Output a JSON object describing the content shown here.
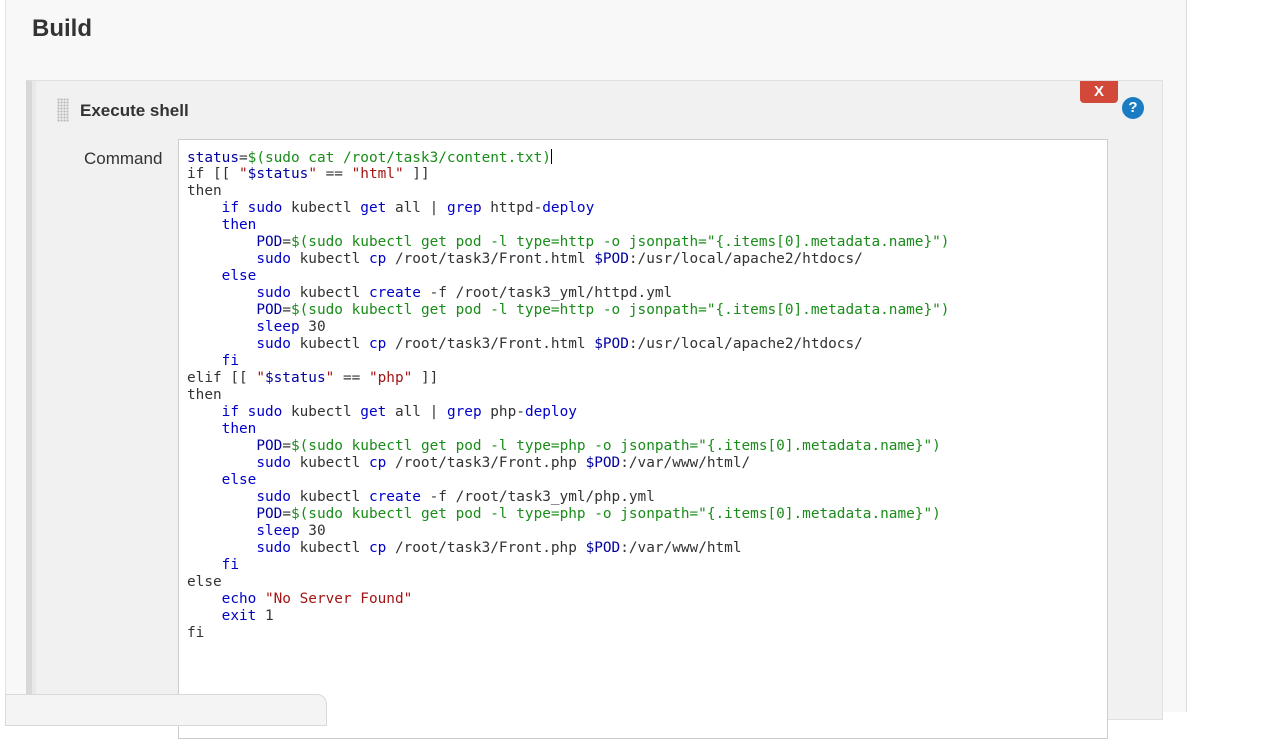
{
  "section": {
    "title": "Build"
  },
  "step": {
    "title": "Execute shell",
    "delete_label": "X",
    "help_label": "?",
    "command_label": "Command"
  },
  "colors": {
    "delete_button": "#d24939",
    "help_icon": "#1a7dc4",
    "variable": "#0000a0",
    "substitution": "#1a8c1a",
    "string": "#a31515"
  },
  "command_lines": [
    [
      [
        "var",
        "status"
      ],
      [
        "txt",
        "="
      ],
      [
        "sub",
        "$(sudo cat /root/task3/content.txt)"
      ]
    ],
    [
      [
        "txt",
        "if [[ "
      ],
      [
        "str",
        "\""
      ],
      [
        "var",
        "$status"
      ],
      [
        "str",
        "\""
      ],
      [
        "txt",
        " == "
      ],
      [
        "str",
        "\"html\""
      ],
      [
        "txt",
        " ]]"
      ]
    ],
    [
      [
        "txt",
        "then"
      ]
    ],
    [
      [
        "txt",
        "    "
      ],
      [
        "cmd",
        "if"
      ],
      [
        "txt",
        " "
      ],
      [
        "cmd",
        "sudo"
      ],
      [
        "txt",
        " kubectl "
      ],
      [
        "cmd",
        "get"
      ],
      [
        "txt",
        " all | "
      ],
      [
        "cmd",
        "grep"
      ],
      [
        "txt",
        " httpd-"
      ],
      [
        "cmd",
        "deploy"
      ]
    ],
    [
      [
        "txt",
        "    "
      ],
      [
        "cmd",
        "then"
      ]
    ],
    [
      [
        "txt",
        "        "
      ],
      [
        "var",
        "POD"
      ],
      [
        "txt",
        "="
      ],
      [
        "sub",
        "$(sudo kubectl get pod -l type=http -o jsonpath=\"{.items[0].metadata.name}\")"
      ]
    ],
    [
      [
        "txt",
        "        "
      ],
      [
        "cmd",
        "sudo"
      ],
      [
        "txt",
        " kubectl "
      ],
      [
        "cmd",
        "cp"
      ],
      [
        "txt",
        " /root/task3/Front.html "
      ],
      [
        "var",
        "$POD"
      ],
      [
        "txt",
        ":/usr/local/apache2/htdocs/"
      ]
    ],
    [
      [
        "txt",
        "    "
      ],
      [
        "cmd",
        "else"
      ]
    ],
    [
      [
        "txt",
        "        "
      ],
      [
        "cmd",
        "sudo"
      ],
      [
        "txt",
        " kubectl "
      ],
      [
        "cmd",
        "create"
      ],
      [
        "txt",
        " -f /root/task3_yml/httpd.yml"
      ]
    ],
    [
      [
        "txt",
        "        "
      ],
      [
        "var",
        "POD"
      ],
      [
        "txt",
        "="
      ],
      [
        "sub",
        "$(sudo kubectl get pod -l type=http -o jsonpath=\"{.items[0].metadata.name}\")"
      ]
    ],
    [
      [
        "txt",
        "        "
      ],
      [
        "cmd",
        "sleep"
      ],
      [
        "txt",
        " 30"
      ]
    ],
    [
      [
        "txt",
        "        "
      ],
      [
        "cmd",
        "sudo"
      ],
      [
        "txt",
        " kubectl "
      ],
      [
        "cmd",
        "cp"
      ],
      [
        "txt",
        " /root/task3/Front.html "
      ],
      [
        "var",
        "$POD"
      ],
      [
        "txt",
        ":/usr/local/apache2/htdocs/"
      ]
    ],
    [
      [
        "txt",
        "    "
      ],
      [
        "cmd",
        "fi"
      ]
    ],
    [
      [
        "txt",
        "elif [[ "
      ],
      [
        "str",
        "\""
      ],
      [
        "var",
        "$status"
      ],
      [
        "str",
        "\""
      ],
      [
        "txt",
        " == "
      ],
      [
        "str",
        "\"php\""
      ],
      [
        "txt",
        " ]]"
      ]
    ],
    [
      [
        "txt",
        "then"
      ]
    ],
    [
      [
        "txt",
        "    "
      ],
      [
        "cmd",
        "if"
      ],
      [
        "txt",
        " "
      ],
      [
        "cmd",
        "sudo"
      ],
      [
        "txt",
        " kubectl "
      ],
      [
        "cmd",
        "get"
      ],
      [
        "txt",
        " all | "
      ],
      [
        "cmd",
        "grep"
      ],
      [
        "txt",
        " php-"
      ],
      [
        "cmd",
        "deploy"
      ]
    ],
    [
      [
        "txt",
        "    "
      ],
      [
        "cmd",
        "then"
      ]
    ],
    [
      [
        "txt",
        "        "
      ],
      [
        "var",
        "POD"
      ],
      [
        "txt",
        "="
      ],
      [
        "sub",
        "$(sudo kubectl get pod -l type=php -o jsonpath=\"{.items[0].metadata.name}\")"
      ]
    ],
    [
      [
        "txt",
        "        "
      ],
      [
        "cmd",
        "sudo"
      ],
      [
        "txt",
        " kubectl "
      ],
      [
        "cmd",
        "cp"
      ],
      [
        "txt",
        " /root/task3/Front.php "
      ],
      [
        "var",
        "$POD"
      ],
      [
        "txt",
        ":/var/www/html/"
      ]
    ],
    [
      [
        "txt",
        "    "
      ],
      [
        "cmd",
        "else"
      ]
    ],
    [
      [
        "txt",
        "        "
      ],
      [
        "cmd",
        "sudo"
      ],
      [
        "txt",
        " kubectl "
      ],
      [
        "cmd",
        "create"
      ],
      [
        "txt",
        " -f /root/task3_yml/php.yml"
      ]
    ],
    [
      [
        "txt",
        "        "
      ],
      [
        "var",
        "POD"
      ],
      [
        "txt",
        "="
      ],
      [
        "sub",
        "$(sudo kubectl get pod -l type=php -o jsonpath=\"{.items[0].metadata.name}\")"
      ]
    ],
    [
      [
        "txt",
        "        "
      ],
      [
        "cmd",
        "sleep"
      ],
      [
        "txt",
        " 30"
      ]
    ],
    [
      [
        "txt",
        "        "
      ],
      [
        "cmd",
        "sudo"
      ],
      [
        "txt",
        " kubectl "
      ],
      [
        "cmd",
        "cp"
      ],
      [
        "txt",
        " /root/task3/Front.php "
      ],
      [
        "var",
        "$POD"
      ],
      [
        "txt",
        ":/var/www/html"
      ]
    ],
    [
      [
        "txt",
        "    "
      ],
      [
        "cmd",
        "fi"
      ]
    ],
    [
      [
        "txt",
        "else"
      ]
    ],
    [
      [
        "txt",
        "    "
      ],
      [
        "cmd",
        "echo"
      ],
      [
        "txt",
        " "
      ],
      [
        "str",
        "\"No Server Found\""
      ]
    ],
    [
      [
        "txt",
        "    "
      ],
      [
        "cmd",
        "exit"
      ],
      [
        "txt",
        " 1"
      ]
    ],
    [
      [
        "txt",
        "fi"
      ]
    ]
  ]
}
